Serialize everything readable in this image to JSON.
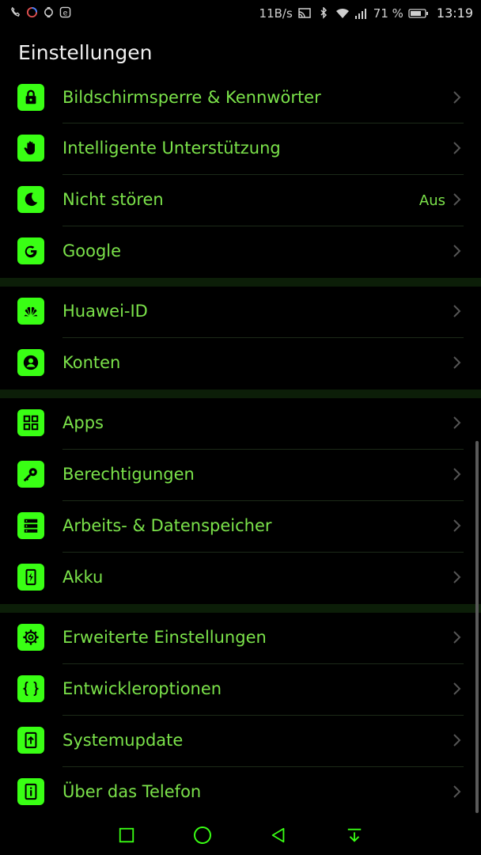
{
  "status_bar": {
    "network_speed": "11B/s",
    "battery_percent": "71 %",
    "time": "13:19"
  },
  "app_bar": {
    "title": "Einstellungen"
  },
  "settings": {
    "group1": [
      {
        "label": "Bildschirmsperre & Kennwörter",
        "icon": "lock-icon"
      },
      {
        "label": "Intelligente Unterstützung",
        "icon": "hand-icon"
      },
      {
        "label": "Nicht stören",
        "value": "Aus",
        "icon": "moon-icon"
      },
      {
        "label": "Google",
        "icon": "google-icon"
      }
    ],
    "group2": [
      {
        "label": "Huawei-ID",
        "icon": "huawei-icon"
      },
      {
        "label": "Konten",
        "icon": "account-icon"
      }
    ],
    "group3": [
      {
        "label": "Apps",
        "icon": "apps-grid-icon"
      },
      {
        "label": "Berechtigungen",
        "icon": "key-icon"
      },
      {
        "label": "Arbeits- & Datenspeicher",
        "icon": "storage-icon"
      },
      {
        "label": "Akku",
        "icon": "battery-icon"
      }
    ],
    "group4": [
      {
        "label": "Erweiterte Einstellungen",
        "icon": "gear-icon"
      },
      {
        "label": "Entwickleroptionen",
        "icon": "braces-icon"
      },
      {
        "label": "Systemupdate",
        "icon": "system-update-icon"
      },
      {
        "label": "Über das Telefon",
        "icon": "info-icon"
      }
    ]
  },
  "colors": {
    "accent": "#39ff14",
    "text": "#7be24a",
    "background": "#000000"
  }
}
